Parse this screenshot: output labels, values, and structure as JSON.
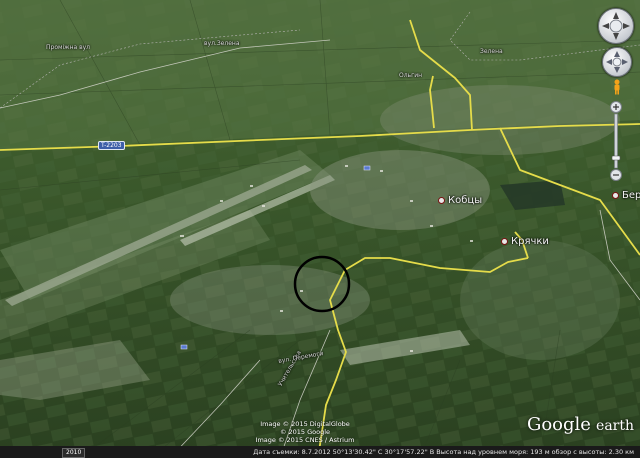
{
  "map": {
    "labels": {
      "kobtsy": "Кобцы",
      "kriachki": "Крячки",
      "berez": "Берез",
      "minor_village_nw": "Проміжна вул",
      "minor_village_nw2": "вул.Зелена",
      "minor_village_n": "Зелена",
      "minor_village_n2": "Ольгин",
      "street_sw": "Учительська",
      "street_sw2": "вул. Перемоги"
    },
    "road_shield": "T-2203",
    "colors": {
      "road_border": "#e5dc4a",
      "terrain_dark": "#27371d",
      "terrain_mid": "#3f5a2c",
      "terrain_light": "#6f8560"
    },
    "highlight_circle": "black-ring-around-settlement"
  },
  "credits": {
    "line1": "Image © 2015 DigitalGlobe",
    "line2": "© 2015 Google",
    "line3": "Image © 2015 CNES / Astrium"
  },
  "logo": {
    "google": "Google",
    "earth": "earth"
  },
  "status": {
    "year": "2010",
    "text": "Дата съемки: 8.7.2012   50°13'30.42\" С   30°17'57.22\" В   Высота над уровнем моря: 193 м   обзор с высоты: 2.30 км"
  },
  "controls": {
    "compass": "compass-icon",
    "look": "look-joystick-icon",
    "street_view": "pegman-icon",
    "zoom": "zoom-slider"
  }
}
